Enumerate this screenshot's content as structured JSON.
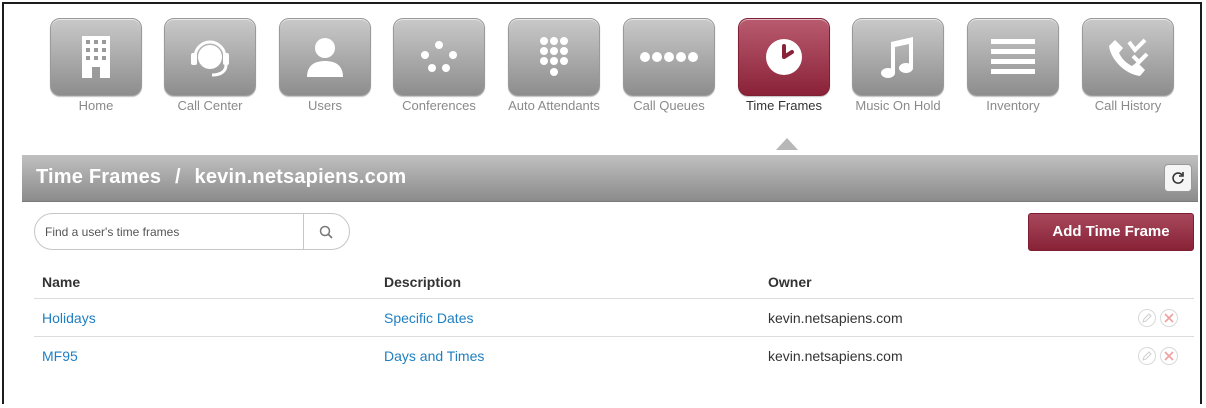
{
  "nav": {
    "items": [
      {
        "label": "Home",
        "icon": "building-icon"
      },
      {
        "label": "Call Center",
        "icon": "headset-icon"
      },
      {
        "label": "Users",
        "icon": "user-icon"
      },
      {
        "label": "Conferences",
        "icon": "dots-cluster-icon"
      },
      {
        "label": "Auto Attendants",
        "icon": "keypad-icon"
      },
      {
        "label": "Call Queues",
        "icon": "queue-dots-icon"
      },
      {
        "label": "Time Frames",
        "icon": "clock-icon",
        "active": true
      },
      {
        "label": "Music On Hold",
        "icon": "music-note-icon"
      },
      {
        "label": "Inventory",
        "icon": "list-lines-icon"
      },
      {
        "label": "Call History",
        "icon": "phone-history-icon"
      }
    ]
  },
  "header": {
    "title": "Time Frames",
    "separator": "/",
    "domain": "kevin.netsapiens.com",
    "refresh_icon": "refresh-icon"
  },
  "search": {
    "placeholder": "Find a user's time frames",
    "icon": "search-icon"
  },
  "actions": {
    "add_label": "Add Time Frame"
  },
  "table": {
    "columns": [
      "Name",
      "Description",
      "Owner"
    ],
    "rows": [
      {
        "name": "Holidays",
        "description": "Specific Dates",
        "owner": "kevin.netsapiens.com"
      },
      {
        "name": "MF95",
        "description": "Days and Times",
        "owner": "kevin.netsapiens.com"
      }
    ]
  },
  "colors": {
    "accent": "#8a2238",
    "link": "#1f7fc1",
    "header_bar": "#9e9e9e"
  }
}
